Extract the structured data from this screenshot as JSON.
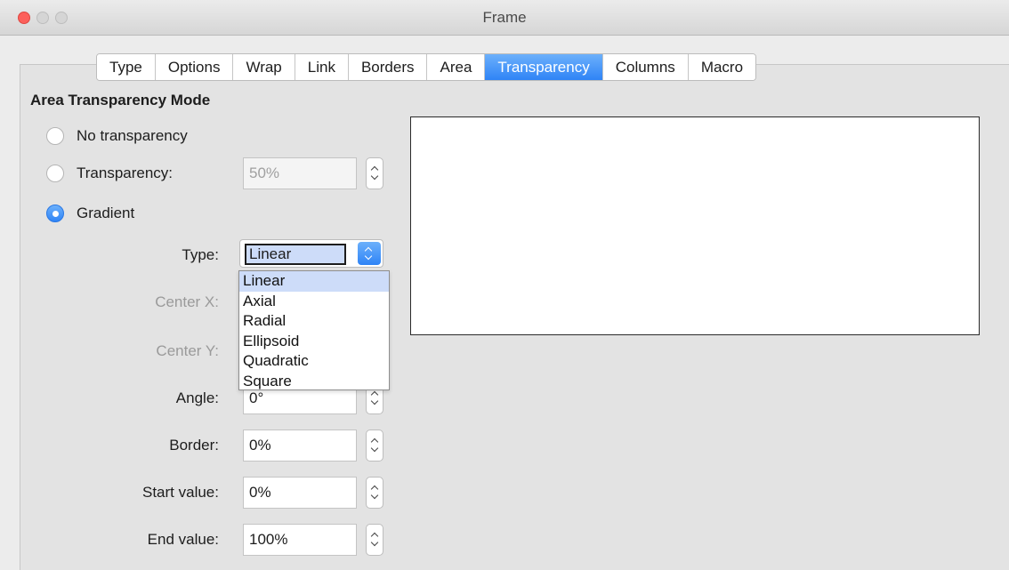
{
  "window": {
    "title": "Frame"
  },
  "tabs": [
    {
      "label": "Type"
    },
    {
      "label": "Options"
    },
    {
      "label": "Wrap"
    },
    {
      "label": "Link"
    },
    {
      "label": "Borders"
    },
    {
      "label": "Area"
    },
    {
      "label": "Transparency",
      "active": true
    },
    {
      "label": "Columns"
    },
    {
      "label": "Macro"
    }
  ],
  "section": {
    "title": "Area Transparency Mode"
  },
  "modes": {
    "no_transparency": {
      "label": "No transparency",
      "checked": false
    },
    "transparency": {
      "label": "Transparency:",
      "checked": false,
      "value": "50%"
    },
    "gradient": {
      "label": "Gradient",
      "checked": true
    }
  },
  "gradient": {
    "type_label": "Type:",
    "type_value": "Linear",
    "type_options": [
      "Linear",
      "Axial",
      "Radial",
      "Ellipsoid",
      "Quadratic",
      "Square"
    ],
    "center_x_label": "Center X:",
    "center_y_label": "Center Y:",
    "angle_label": "Angle:",
    "angle_value": "0°",
    "border_label": "Border:",
    "border_value": "0%",
    "start_label": "Start value:",
    "start_value": "0%",
    "end_label": "End value:",
    "end_value": "100%"
  },
  "colors": {
    "accent": "#2f84f6",
    "selection": "#cddcf9",
    "close_button": "#fc605b"
  }
}
